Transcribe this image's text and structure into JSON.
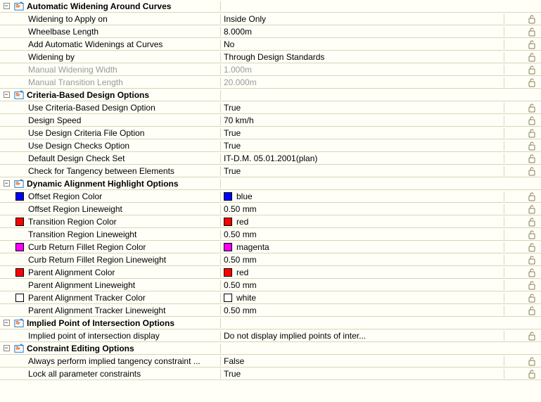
{
  "sections": [
    {
      "title": "Automatic Widening Around Curves",
      "key": "auto_widening",
      "rows": [
        {
          "label": "Widening to Apply on",
          "value": "Inside Only",
          "lock": true
        },
        {
          "label": "Wheelbase Length",
          "value": "8.000m",
          "lock": true
        },
        {
          "label": "Add Automatic Widenings at Curves",
          "value": "No",
          "lock": true
        },
        {
          "label": "Widening by",
          "value": "Through Design Standards",
          "lock": true
        },
        {
          "label": "Manual Widening Width",
          "value": "1.000m",
          "lock": true,
          "disabled": true
        },
        {
          "label": "Manual Transition Length",
          "value": "20.000m",
          "lock": true,
          "disabled": true
        }
      ]
    },
    {
      "title": "Criteria-Based Design Options",
      "key": "criteria_design",
      "rows": [
        {
          "label": "Use Criteria-Based Design Option",
          "value": "True",
          "lock": true
        },
        {
          "label": "Design Speed",
          "value": "70 km/h",
          "lock": true
        },
        {
          "label": "Use Design Criteria File Option",
          "value": "True",
          "lock": true
        },
        {
          "label": "Use Design Checks Option",
          "value": "True",
          "lock": true
        },
        {
          "label": "Default Design Check Set",
          "value": "IT-D.M. 05.01.2001(plan)",
          "lock": true
        },
        {
          "label": "Check for Tangency between Elements",
          "value": "True",
          "lock": true
        }
      ]
    },
    {
      "title": "Dynamic Alignment Highlight Options",
      "key": "dynamic_highlight",
      "rows": [
        {
          "label": "Offset Region Color",
          "value": "blue",
          "swatch": "#0000ff",
          "label_swatch": "#0000ff",
          "lock": true
        },
        {
          "label": "Offset Region Lineweight",
          "value": "0.50 mm",
          "lock": true
        },
        {
          "label": "Transition Region Color",
          "value": "red",
          "swatch": "#ff0000",
          "label_swatch": "#ff0000",
          "lock": true
        },
        {
          "label": "Transition Region Lineweight",
          "value": "0.50 mm",
          "lock": true
        },
        {
          "label": "Curb Return Fillet Region Color",
          "value": "magenta",
          "swatch": "#ff00ff",
          "label_swatch": "#ff00ff",
          "lock": true
        },
        {
          "label": "Curb Return Fillet Region Lineweight",
          "value": "0.50 mm",
          "lock": true
        },
        {
          "label": "Parent Alignment Color",
          "value": "red",
          "swatch": "#ff0000",
          "label_swatch": "#ff0000",
          "lock": true
        },
        {
          "label": "Parent Alignment Lineweight",
          "value": "0.50 mm",
          "lock": true
        },
        {
          "label": "Parent Alignment Tracker Color",
          "value": "white",
          "swatch": "#ffffff",
          "label_swatch": "#ffffff",
          "lock": true
        },
        {
          "label": "Parent Alignment Tracker Lineweight",
          "value": "0.50 mm",
          "lock": true
        }
      ]
    },
    {
      "title": "Implied Point of Intersection Options",
      "key": "implied_point",
      "rows": [
        {
          "label": "Implied point of intersection display",
          "value": "Do not display implied points of inter...",
          "lock": true
        }
      ]
    },
    {
      "title": "Constraint Editing Options",
      "key": "constraint_editing",
      "rows": [
        {
          "label": "Always perform implied tangency constraint ...",
          "value": "False",
          "lock": true
        },
        {
          "label": "Lock all parameter constraints",
          "value": "True",
          "lock": true
        }
      ]
    }
  ]
}
